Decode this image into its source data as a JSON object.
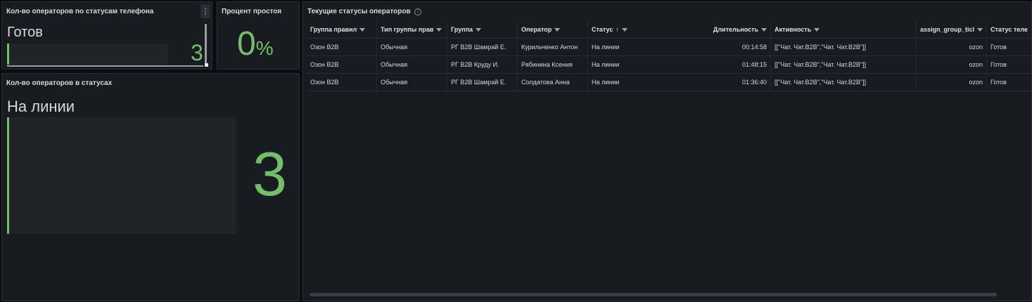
{
  "panel_phone_status": {
    "title": "Кол-во операторов по статусам телефона",
    "label": "Готов",
    "value": "3",
    "menu_icon": "more-vertical-icon"
  },
  "panel_idle": {
    "title": "Процент простоя",
    "value": "0",
    "unit": "%"
  },
  "panel_status_count": {
    "title": "Кол-во операторов в статусах",
    "label": "На линии",
    "value": "3"
  },
  "panel_table": {
    "title": "Текущие статусы операторов",
    "info_icon": "info-icon",
    "columns": [
      "Группа правил",
      "Тип группы прав",
      "Группа",
      "Оператор",
      "Статус",
      "Длительность",
      "Активность",
      "assign_group_ticl",
      "Статус теле"
    ],
    "rows": [
      [
        "Озон B2B",
        "Обычная",
        "РГ B2B Шамрай Е.",
        "Курильченко Антон",
        "На линии",
        "00:14:58",
        "[[\"Чат. Чат.B2B\",\"Чат. Чат.B2B\"]]",
        "ozon",
        "Готов"
      ],
      [
        "Озон B2B",
        "Обычная",
        "РГ B2B Круду И.",
        "Рябинина Ксения",
        "На линии",
        "01:48:15",
        "[[\"Чат. Чат.B2B\",\"Чат. Чат.B2B\"]]",
        "ozon",
        "Готов"
      ],
      [
        "Озон B2B",
        "Обычная",
        "РГ B2B Шамрай Е.",
        "Солдатова Анна",
        "На линии",
        "01:36:40",
        "[[\"Чат. Чат.B2B\",\"Чат. Чат.B2B\"]]",
        "ozon",
        "Готов"
      ]
    ],
    "accent_color": "#73bf69"
  }
}
